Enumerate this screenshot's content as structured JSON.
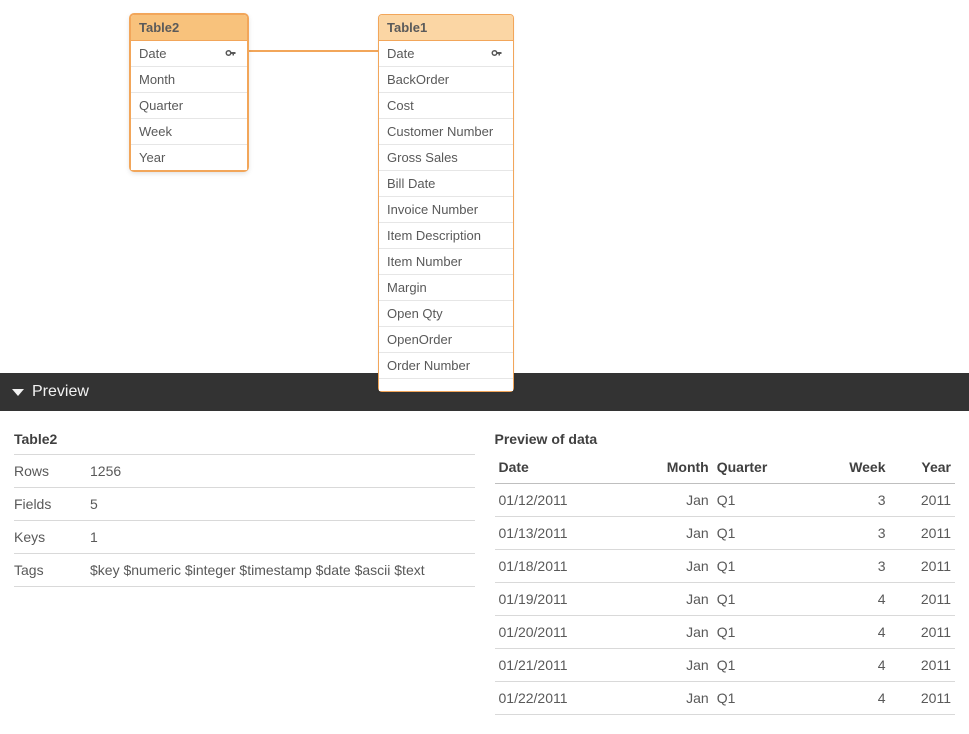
{
  "model": {
    "table2": {
      "name": "Table2",
      "fields": [
        {
          "name": "Date",
          "key": true
        },
        {
          "name": "Month",
          "key": false
        },
        {
          "name": "Quarter",
          "key": false
        },
        {
          "name": "Week",
          "key": false
        },
        {
          "name": "Year",
          "key": false
        }
      ]
    },
    "table1": {
      "name": "Table1",
      "fields": [
        {
          "name": "Date",
          "key": true
        },
        {
          "name": "BackOrder",
          "key": false
        },
        {
          "name": "Cost",
          "key": false
        },
        {
          "name": "Customer Number",
          "key": false
        },
        {
          "name": "Gross Sales",
          "key": false
        },
        {
          "name": "Bill Date",
          "key": false
        },
        {
          "name": "Invoice Number",
          "key": false
        },
        {
          "name": "Item Description",
          "key": false
        },
        {
          "name": "Item Number",
          "key": false
        },
        {
          "name": "Margin",
          "key": false
        },
        {
          "name": "Open Qty",
          "key": false
        },
        {
          "name": "OpenOrder",
          "key": false
        },
        {
          "name": "Order Number",
          "key": false
        }
      ]
    }
  },
  "previewBar": {
    "label": "Preview"
  },
  "meta": {
    "title": "Table2",
    "rows_label": "Rows",
    "rows_value": "1256",
    "fields_label": "Fields",
    "fields_value": "5",
    "keys_label": "Keys",
    "keys_value": "1",
    "tags_label": "Tags",
    "tags_value": "$key $numeric $integer $timestamp $date $ascii $text"
  },
  "dataPreview": {
    "title": "Preview of data",
    "columns": [
      "Date",
      "Month",
      "Quarter",
      "Week",
      "Year"
    ],
    "align": [
      "l",
      "r",
      "l",
      "r",
      "r"
    ],
    "rows": [
      [
        "01/12/2011",
        "Jan",
        "Q1",
        "3",
        "2011"
      ],
      [
        "01/13/2011",
        "Jan",
        "Q1",
        "3",
        "2011"
      ],
      [
        "01/18/2011",
        "Jan",
        "Q1",
        "3",
        "2011"
      ],
      [
        "01/19/2011",
        "Jan",
        "Q1",
        "4",
        "2011"
      ],
      [
        "01/20/2011",
        "Jan",
        "Q1",
        "4",
        "2011"
      ],
      [
        "01/21/2011",
        "Jan",
        "Q1",
        "4",
        "2011"
      ],
      [
        "01/22/2011",
        "Jan",
        "Q1",
        "4",
        "2011"
      ]
    ]
  }
}
